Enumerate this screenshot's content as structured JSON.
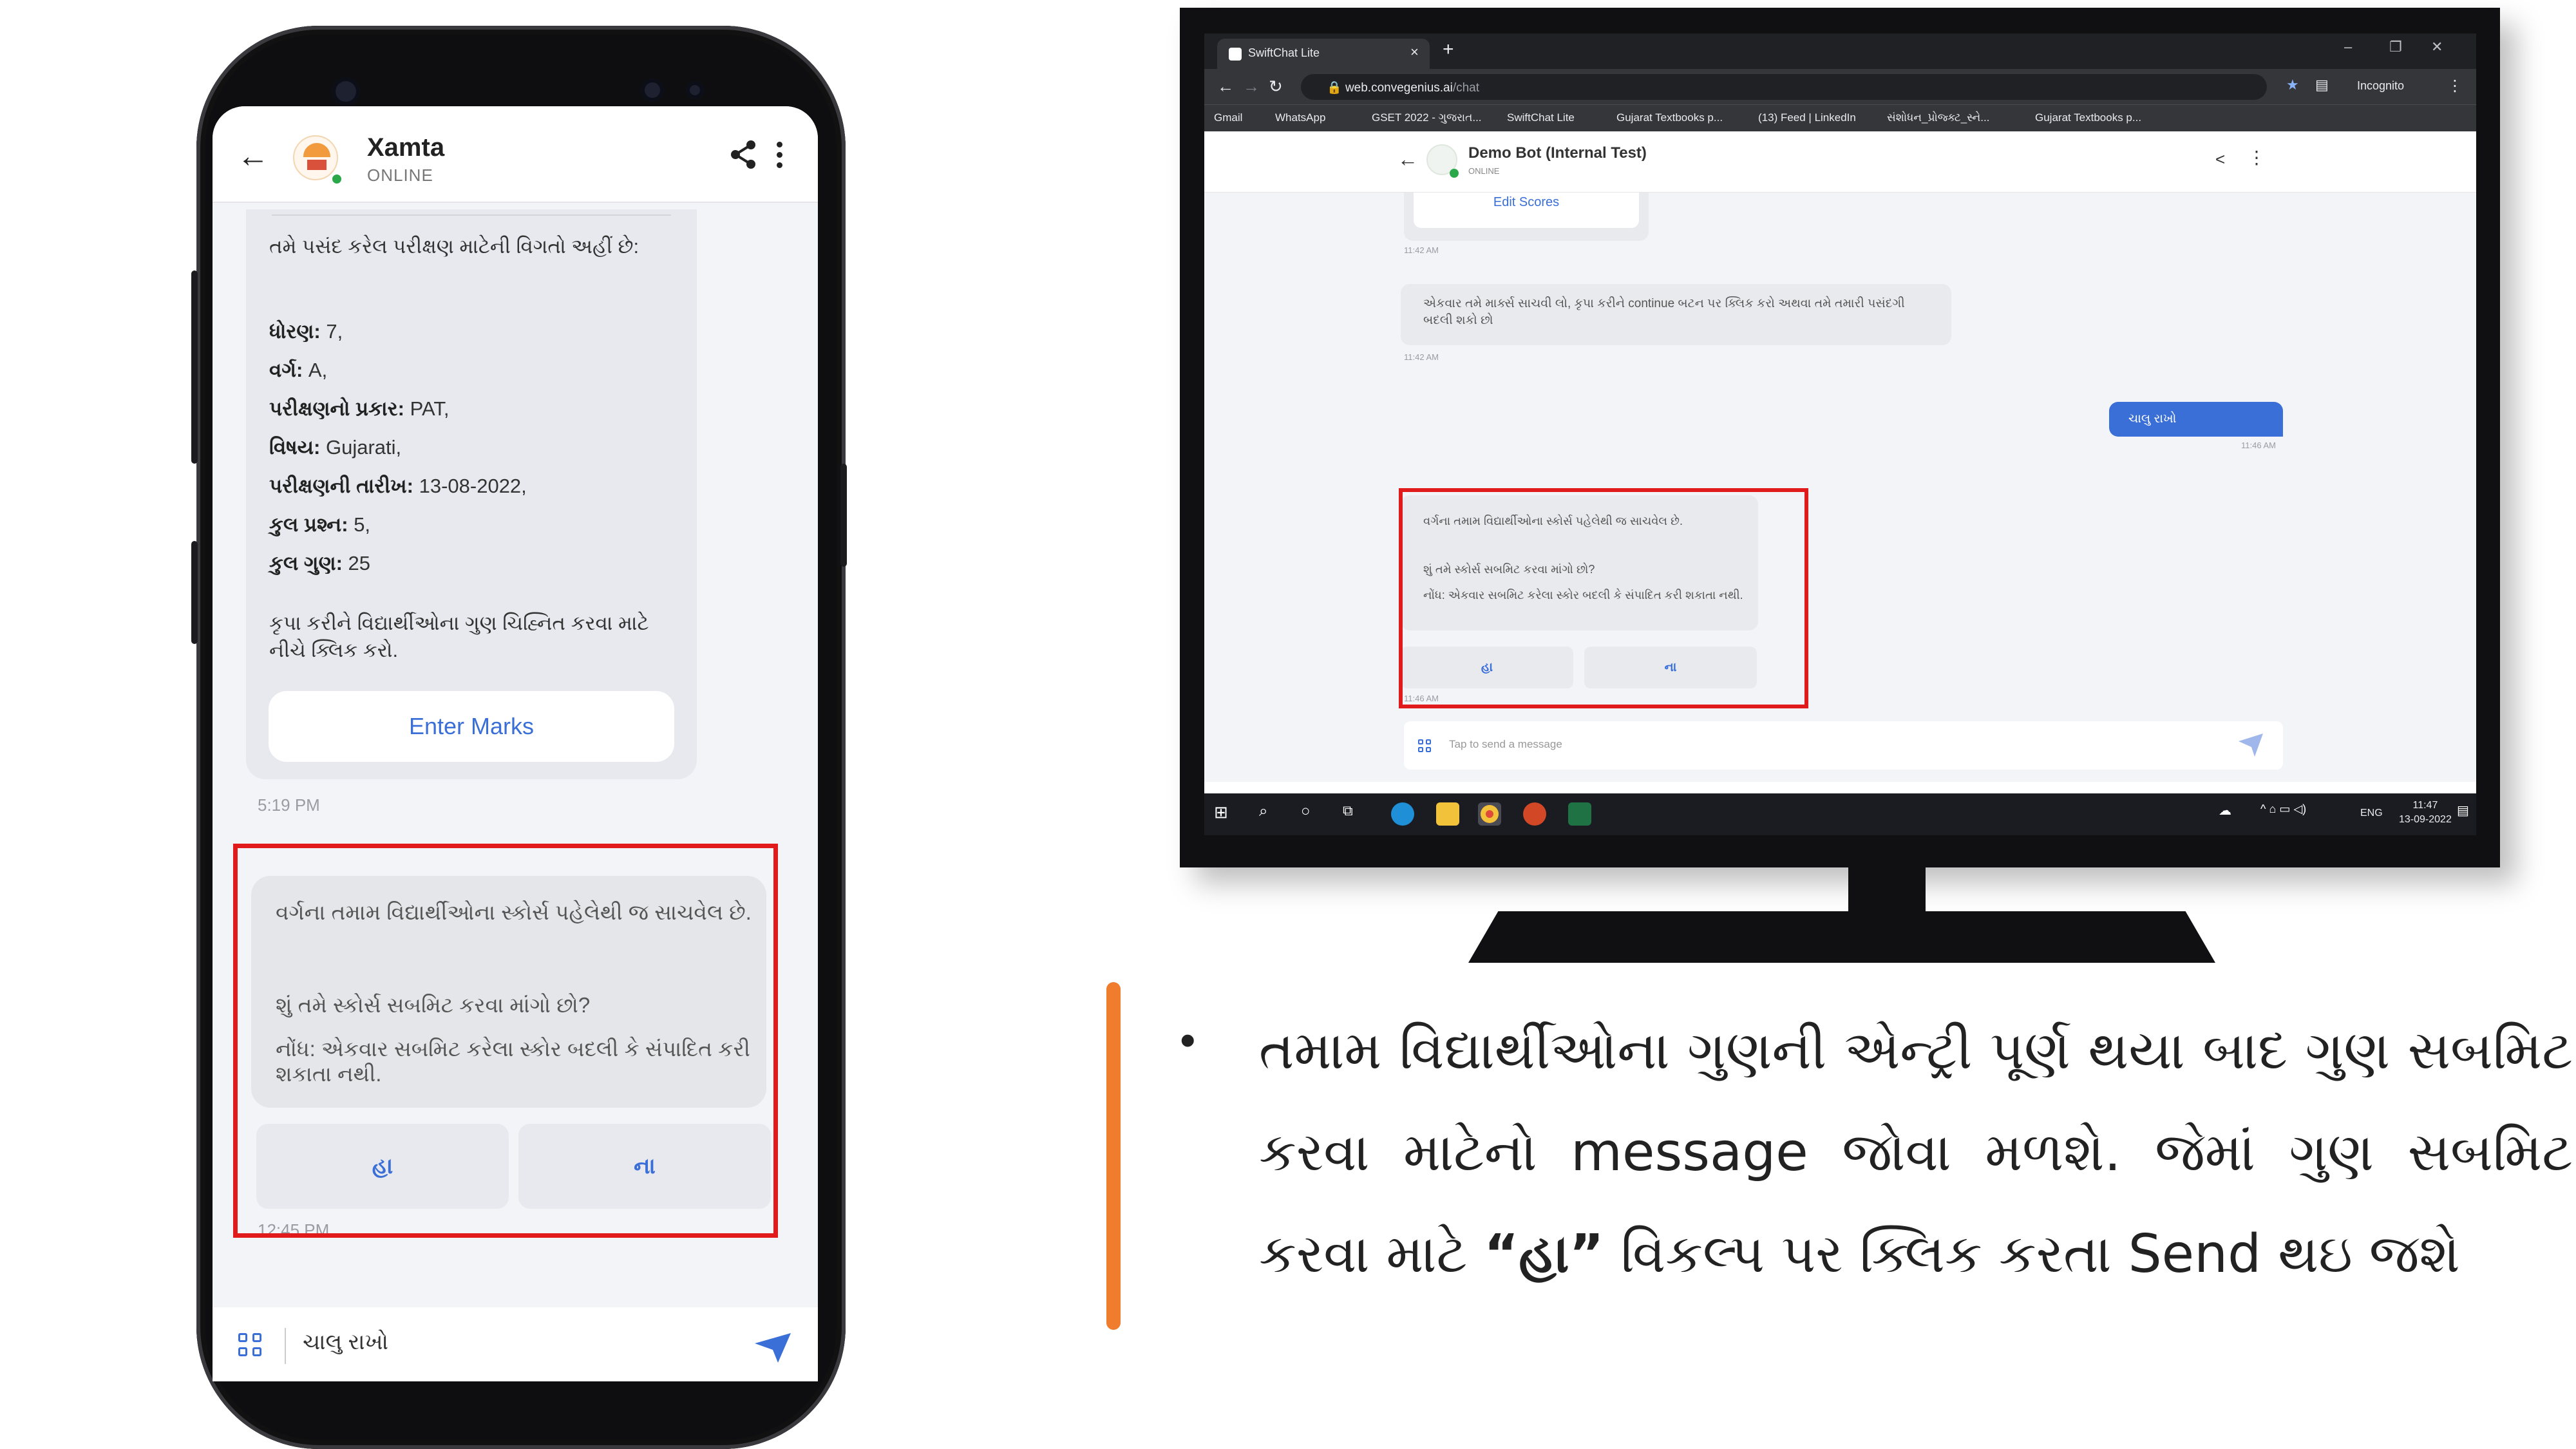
{
  "phone": {
    "header": {
      "title": "Xamta",
      "status": "ONLINE"
    },
    "message1": {
      "intro": "તમે પસંદ કરેલ પરીક્ષણ માટેની વિગતો અહીં છે:",
      "fields": [
        {
          "label": "ધોરણ:",
          "value": " 7,"
        },
        {
          "label": "વર્ગ:",
          "value": " A,"
        },
        {
          "label": "પરીક્ષણનો પ્રકાર:",
          "value": " PAT,"
        },
        {
          "label": "વિષય:",
          "value": " Gujarati,"
        },
        {
          "label": "પરીક્ષણની તારીખ:",
          "value": " 13-08-2022,"
        },
        {
          "label": "કુલ પ્રશ્ન:",
          "value": " 5,"
        },
        {
          "label": "કુલ ગુણ:",
          "value": " 25"
        }
      ],
      "note": "કૃપા કરીને વિદ્યાર્થીઓના ગુણ ચિહ્નિત કરવા માટે નીચે ક્લિક કરો.",
      "button": "Enter Marks",
      "time": "5:19 PM"
    },
    "message2": {
      "line1": "વર્ગના તમામ વિદ્યાર્થીઓના સ્કોર્સ પહેલેથી જ સાચવેલ છે.",
      "line2": "શું તમે સ્કોર્સ સબમિટ કરવા માંગો છો?",
      "line3": "નોંધ: એકવાર સબમિટ કરેલા સ્કોર બદલી કે સંપાદિત કરી શકાતા નથી.",
      "yes": "હા",
      "no": "ના",
      "time": "12:45 PM"
    },
    "input_text": "ચાલુ રાખો"
  },
  "browser": {
    "tab_title": "SwiftChat Lite",
    "url_domain": "web.convegenius.ai",
    "url_path": "/chat",
    "incognito": "Incognito",
    "bookmarks": [
      "Gmail",
      "WhatsApp",
      "GSET 2022 - ગુજરાત...",
      "SwiftChat Lite",
      "Gujarat Textbooks p...",
      "(13) Feed | LinkedIn",
      "સંશોધન_પ્રોજ્ક્ટ_સ્ને...",
      "Gujarat Textbooks p..."
    ],
    "chat": {
      "title": "Demo Bot (Internal Test)",
      "status": "ONLINE",
      "edit_scores": "Edit Scores",
      "time1": "11:42 AM",
      "msg1": "એકવાર તમે માર્ક્સ સાચવી લો, કૃપા કરીને continue બટન પર ક્લિક કરો અથવા તમે તમારી પસંદગી બદલી શકો છો",
      "time2": "11:42 AM",
      "user_msg": "ચાલુ રાખો",
      "time3": "11:46 AM",
      "msg2_line1": "વર્ગના તમામ વિદ્યાર્થીઓના સ્કોર્સ પહેલેથી જ સાચવેલ છે.",
      "msg2_line2": "શું તમે સ્કોર્સ સબમિટ કરવા માંગો છો?",
      "msg2_line3": "નોંધ: એકવાર સબમિટ કરેલા સ્કોર બદલી કે સંપાદિત કરી શકાતા નથી.",
      "yes": "હા",
      "no": "ના",
      "time4": "11:46 AM",
      "input_placeholder": "Tap to send a message"
    },
    "taskbar": {
      "lang": "ENG",
      "time": "11:47",
      "date": "13-09-2022"
    }
  },
  "description": {
    "part1": "તમામ વિદ્યાર્થીઓના ગુણની એન્ટ્રી પૂર્ણ થયા બાદ ગુણ સબમિટ કરવા માટેનો message જોવા મળશે. જેમાં ગુણ સબમિટ કરવા માટે ",
    "highlight": "“હા”",
    "part2": " વિકલ્પ પર ક્લિક કરતા Send થઇ જશે"
  },
  "colors": {
    "accent": "#3b6fd8",
    "highlight_box": "#e11b1b",
    "orange_bar": "#ef7d2d",
    "online": "#2aa84a"
  }
}
